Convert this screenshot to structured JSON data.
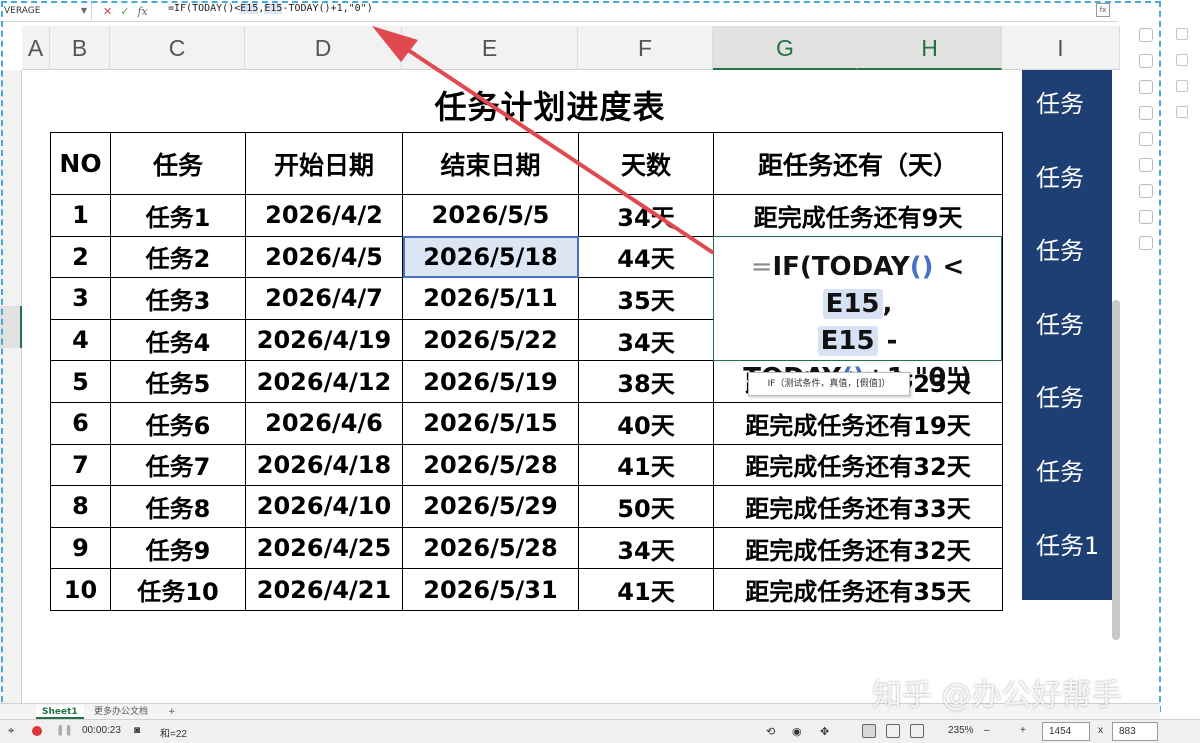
{
  "formula_bar": {
    "name_box": "VERAGE",
    "cancel_icon": "✕",
    "confirm_icon": "✓",
    "fx_label": "fx",
    "formula_prefix": "=IF(TODAY()<",
    "formula_ref1": "E15",
    "formula_sep": ",",
    "formula_ref2": "E15",
    "formula_suffix": "-TODAY()+1,\"0\")"
  },
  "columns": [
    "A",
    "B",
    "C",
    "D",
    "E",
    "F",
    "G",
    "H",
    "I"
  ],
  "title": "任务计划进度表",
  "table": {
    "headers": [
      "NO",
      "任务",
      "开始日期",
      "结束日期",
      "天数",
      "距任务还有（天）"
    ],
    "rows": [
      [
        "1",
        "任务1",
        "2026/4/2",
        "2026/5/5",
        "34天",
        "距完成任务还有9天"
      ],
      [
        "2",
        "任务2",
        "2026/4/5",
        "2026/5/18",
        "44天",
        ""
      ],
      [
        "3",
        "任务3",
        "2026/4/7",
        "2026/5/11",
        "35天",
        ""
      ],
      [
        "4",
        "任务4",
        "2026/4/19",
        "2026/5/22",
        "34天",
        ""
      ],
      [
        "5",
        "任务5",
        "2026/4/12",
        "2026/5/19",
        "38天",
        "距完成任务还有23天"
      ],
      [
        "6",
        "任务6",
        "2026/4/6",
        "2026/5/15",
        "40天",
        "距完成任务还有19天"
      ],
      [
        "7",
        "任务7",
        "2026/4/18",
        "2026/5/28",
        "41天",
        "距完成任务还有32天"
      ],
      [
        "8",
        "任务8",
        "2026/4/10",
        "2026/5/29",
        "50天",
        "距完成任务还有33天"
      ],
      [
        "9",
        "任务9",
        "2026/4/25",
        "2026/5/28",
        "34天",
        "距完成任务还有32天"
      ],
      [
        "10",
        "任务10",
        "2026/4/21",
        "2026/5/31",
        "41天",
        "距完成任务还有35天"
      ]
    ]
  },
  "edit_cell": {
    "eq": "=",
    "fn_if": "IF(",
    "fn_today": "TODAY",
    "parens": "()",
    "lt": " < ",
    "ref1": "E15",
    "comma": ",",
    "ref2": "E15",
    "minus": " -",
    "fn_today2": "TODAY",
    "parens2": "()",
    "tail": "+1,\"0\")"
  },
  "tooltip": "IF（测试条件，真值，[假值]）",
  "right_panel": {
    "items": [
      "任务",
      "任务",
      "任务",
      "任务",
      "任务",
      "任务",
      "任务1"
    ]
  },
  "sheet_tabs": {
    "active": "Sheet1",
    "other": "更多办公文档",
    "add": "+"
  },
  "status_bar": {
    "timer": "00:00:23",
    "sum": "和=22",
    "zoom": "235%",
    "width_value": "1454",
    "times": "x",
    "height_value": "883"
  },
  "watermark": "知乎 @办公好帮手",
  "colors": {
    "accent_green": "#217346",
    "selection_blue": "#4a72c4",
    "panel_navy": "#1e3f73",
    "arrow_red": "#e0494f",
    "record_red": "#d8373b"
  }
}
